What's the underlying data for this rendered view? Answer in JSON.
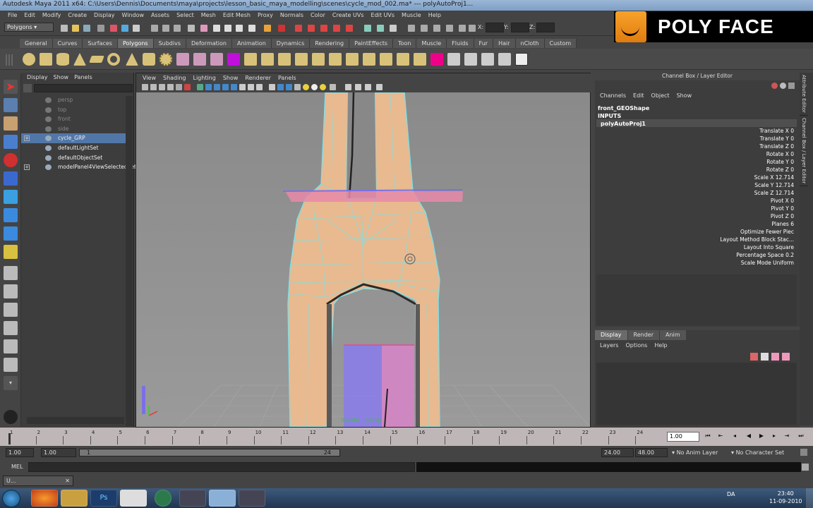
{
  "window": {
    "title": "Autodesk Maya 2011 x64: C:\\Users\\Dennis\\Documents\\maya\\projects\\lesson_basic_maya_modelling\\scenes\\cycle_mod_002.ma*   ---   polyAutoProj1..."
  },
  "menubar": [
    "File",
    "Edit",
    "Modify",
    "Create",
    "Display",
    "Window",
    "Assets",
    "Select",
    "Mesh",
    "Edit Mesh",
    "Proxy",
    "Normals",
    "Color",
    "Create UVs",
    "Edit UVs",
    "Muscle",
    "Help"
  ],
  "status": {
    "mode": "Polygons",
    "x_label": "X:",
    "y_label": "Y:",
    "z_label": "Z:"
  },
  "logo": {
    "text": "POLY FACE"
  },
  "shelf_tabs": [
    "General",
    "Curves",
    "Surfaces",
    "Polygons",
    "Subdivs",
    "Deformation",
    "Animation",
    "Dynamics",
    "Rendering",
    "PaintEffects",
    "Toon",
    "Muscle",
    "Fluids",
    "Fur",
    "Hair",
    "nCloth",
    "Custom"
  ],
  "shelf_active": "Polygons",
  "outliner": {
    "menu": [
      "Display",
      "Show",
      "Panels"
    ],
    "items": [
      {
        "label": "persp",
        "dim": true
      },
      {
        "label": "top",
        "dim": true
      },
      {
        "label": "front",
        "dim": true
      },
      {
        "label": "side",
        "dim": true
      },
      {
        "label": "cycle_GRP",
        "dim": false,
        "selected": true,
        "expand": "+"
      },
      {
        "label": "defaultLightSet",
        "dim": false
      },
      {
        "label": "defaultObjectSet",
        "dim": false
      },
      {
        "label": "modelPanel4ViewSelectedSet",
        "dim": false,
        "expand": "+"
      }
    ]
  },
  "viewport": {
    "menu": [
      "View",
      "Shading",
      "Lighting",
      "Show",
      "Renderer",
      "Panels"
    ],
    "isolate_label": "Isolate : persp"
  },
  "channel_box": {
    "title": "Channel Box / Layer Editor",
    "menu": [
      "Channels",
      "Edit",
      "Object",
      "Show"
    ],
    "object": "front_GEOShape",
    "inputs_label": "INPUTS",
    "input_node": "polyAutoProj1",
    "attributes": [
      {
        "name": "Translate X",
        "value": "0"
      },
      {
        "name": "Translate Y",
        "value": "0"
      },
      {
        "name": "Translate Z",
        "value": "0"
      },
      {
        "name": "Rotate X",
        "value": "0"
      },
      {
        "name": "Rotate Y",
        "value": "0"
      },
      {
        "name": "Rotate Z",
        "value": "0"
      },
      {
        "name": "Scale X",
        "value": "12.714"
      },
      {
        "name": "Scale Y",
        "value": "12.714"
      },
      {
        "name": "Scale Z",
        "value": "12.714"
      },
      {
        "name": "Pivot X",
        "value": "0"
      },
      {
        "name": "Pivot Y",
        "value": "0"
      },
      {
        "name": "Pivot Z",
        "value": "0"
      },
      {
        "name": "Planes",
        "value": "6"
      },
      {
        "name": "Optimize",
        "value": "Fewer Piec"
      },
      {
        "name": "Layout Method",
        "value": "Block Stac..."
      },
      {
        "name": "Layout",
        "value": "Into Square"
      },
      {
        "name": "Percentage Space",
        "value": "0.2"
      },
      {
        "name": "Scale Mode",
        "value": "Uniform"
      }
    ]
  },
  "side_tabs": [
    "Attribute Editor",
    "Channel Box / Layer Editor"
  ],
  "layer_editor": {
    "tabs": [
      "Display",
      "Render",
      "Anim"
    ],
    "active": "Display",
    "menu": [
      "Layers",
      "Options",
      "Help"
    ]
  },
  "timeline": {
    "ticks": [
      "1",
      "2",
      "3",
      "4",
      "5",
      "6",
      "7",
      "8",
      "9",
      "10",
      "11",
      "12",
      "13",
      "14",
      "15",
      "16",
      "17",
      "18",
      "19",
      "20",
      "21",
      "22",
      "23",
      "24"
    ],
    "current": "1.00"
  },
  "range": {
    "start": "1.00",
    "start2": "1.00",
    "slider_start": "1",
    "slider_end": "24",
    "end": "24.00",
    "end2": "48.00",
    "anim_layer": "No Anim Layer",
    "char_set": "No Character Set"
  },
  "mel": {
    "label": "MEL"
  },
  "minimized": {
    "label": "U..."
  },
  "taskbar": {
    "tray_lang": "DA",
    "time": "23:40",
    "date": "11-09-2010"
  }
}
